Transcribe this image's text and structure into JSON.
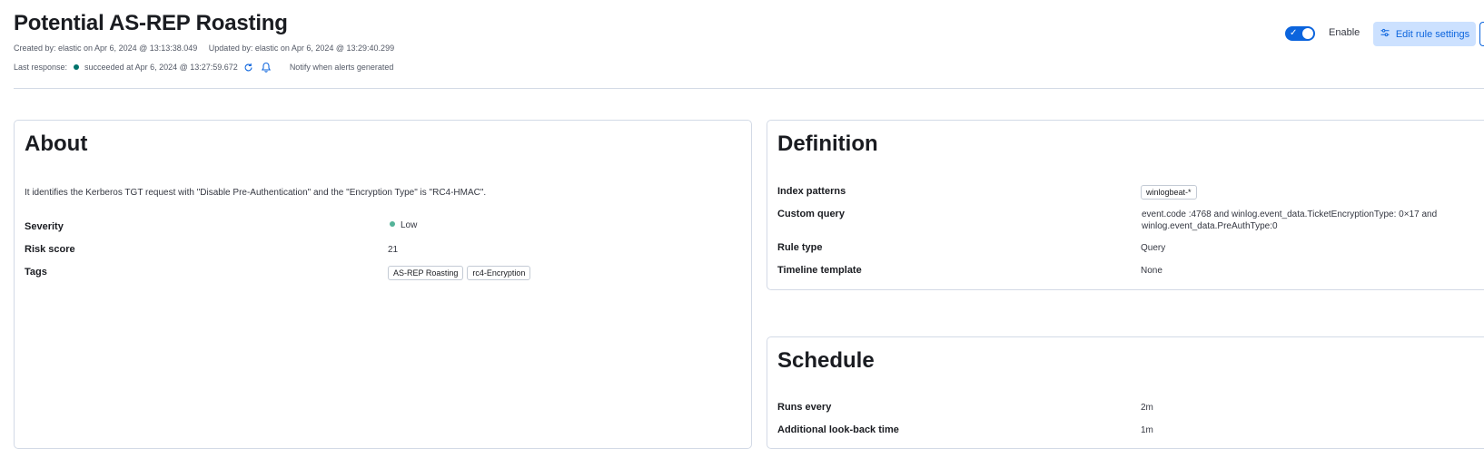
{
  "header": {
    "title": "Potential AS-REP Roasting",
    "created": "Created by: elastic on Apr 6, 2024 @ 13:13:38.049",
    "updated": "Updated by: elastic on Apr 6, 2024 @ 13:29:40.299",
    "last_response_label": "Last response:",
    "last_response_status": "succeeded at Apr 6, 2024 @ 13:27:59.672",
    "notify_text": "Notify when alerts generated",
    "enable_label": "Enable",
    "edit_button_label": "Edit rule settings",
    "toggle_enabled": true
  },
  "about": {
    "title": "About",
    "description": "It identifies the Kerberos TGT request with \"Disable Pre-Authentication\" and the \"Encryption Type\" is \"RC4-HMAC\".",
    "severity_label": "Severity",
    "severity_value": "Low",
    "risk_label": "Risk score",
    "risk_value": "21",
    "tags_label": "Tags",
    "tags": [
      "AS-REP Roasting",
      "rc4-Encryption"
    ]
  },
  "definition": {
    "title": "Definition",
    "index_label": "Index patterns",
    "index_value": "winlogbeat-*",
    "query_label": "Custom query",
    "query_value": "event.code :4768 and winlog.event_data.TicketEncryptionType: 0×17  and winlog.event_data.PreAuthType:0",
    "rule_type_label": "Rule type",
    "rule_type_value": "Query",
    "timeline_label": "Timeline template",
    "timeline_value": "None"
  },
  "schedule": {
    "title": "Schedule",
    "runs_label": "Runs every",
    "runs_value": "2m",
    "lookback_label": "Additional look-back time",
    "lookback_value": "1m"
  },
  "colors": {
    "primary": "#0b64dd",
    "success": "#00726b",
    "severity_low": "#54b399",
    "border": "#d3dae6"
  }
}
